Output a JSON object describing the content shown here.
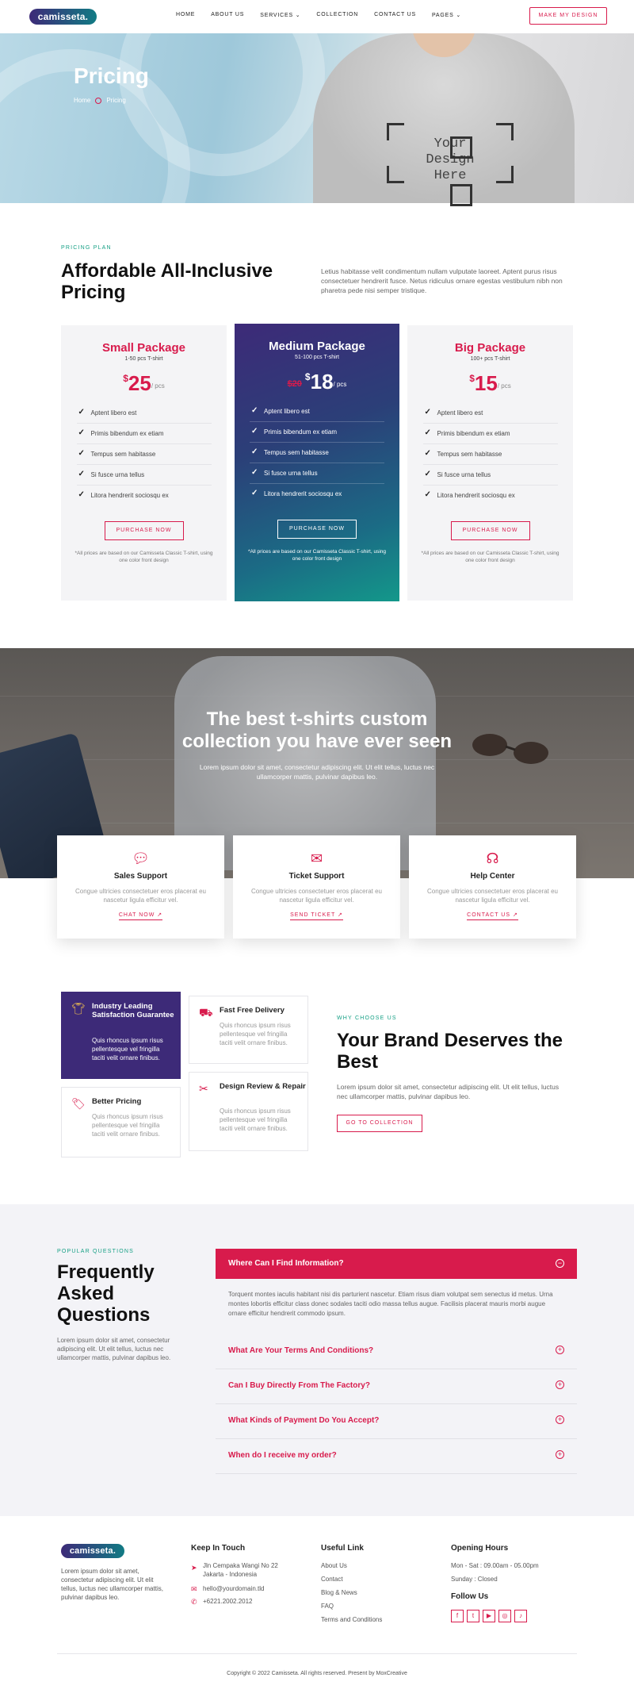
{
  "brand": {
    "logo": "camisseta.",
    "accent": "#d81b4c",
    "green": "#16a085",
    "purple": "#3d2a78"
  },
  "nav": {
    "items": [
      "HOME",
      "ABOUT US",
      "SERVICES",
      "COLLECTION",
      "CONTACT US",
      "PAGES"
    ],
    "active": "PAGES",
    "cta": "MAKE MY DESIGN"
  },
  "hero": {
    "title": "Pricing",
    "breadcrumb": [
      "Home",
      "Pricing"
    ],
    "design_text": "Your Design Here"
  },
  "pricing": {
    "eyebrow": "PRICING PLAN",
    "title": "Affordable All-Inclusive Pricing",
    "lead": "Letius habitasse velit condimentum nullam vulputate laoreet. Aptent purus risus consectetuer hendrerit fusce. Netus ridiculus ornare egestas vestibulum nibh non pharetra pede nisi semper tristique.",
    "plans": [
      {
        "name": "Small Package",
        "qty": "1-50 pcs T-shirt",
        "currency": "$",
        "price": "25",
        "per": "/ pcs",
        "old": "",
        "features": [
          "Aptent libero est",
          "Primis bibendum ex etiam",
          "Tempus sem habitasse",
          "Si fusce urna tellus",
          "Litora hendrerit sociosqu ex"
        ],
        "button": "PURCHASE NOW",
        "note": "*All prices are based on our Camisseta Classic T-shirt, using one color front design"
      },
      {
        "name": "Medium Package",
        "qty": "51-100 pcs T-shirt",
        "currency": "$",
        "price": "18",
        "per": "/ pcs",
        "old": "$20",
        "features": [
          "Aptent libero est",
          "Primis bibendum ex etiam",
          "Tempus sem habitasse",
          "Si fusce urna tellus",
          "Litora hendrerit sociosqu ex"
        ],
        "button": "PURCHASE NOW",
        "note": "*All prices are based on our Camisseta Classic T-shirt, using one color front design"
      },
      {
        "name": "Big Package",
        "qty": "100+ pcs T-shirt",
        "currency": "$",
        "price": "15",
        "per": "/ pcs",
        "old": "",
        "features": [
          "Aptent libero est",
          "Primis bibendum ex etiam",
          "Tempus sem habitasse",
          "Si fusce urna tellus",
          "Litora hendrerit sociosqu ex"
        ],
        "button": "PURCHASE NOW",
        "note": "*All prices are based on our Camisseta Classic T-shirt, using one color front design"
      }
    ]
  },
  "banner": {
    "title_line1": "The best t-shirts custom",
    "title_line2": "collection you have ever seen",
    "sub": "Lorem ipsum dolor sit amet, consectetur adipiscing elit. Ut elit tellus, luctus nec ullamcorper mattis, pulvinar dapibus leo."
  },
  "services": [
    {
      "icon": "chat-icon",
      "title": "Sales Support",
      "text": "Congue ultricies consectetuer eros placerat eu nascetur ligula efficitur vel.",
      "link": "CHAT NOW"
    },
    {
      "icon": "mail-icon",
      "title": "Ticket Support",
      "text": "Congue ultricies consectetuer eros placerat eu nascetur ligula efficitur vel.",
      "link": "SEND TICKET"
    },
    {
      "icon": "headset-icon",
      "title": "Help Center",
      "text": "Congue ultricies consectetuer eros placerat eu nascetur ligula efficitur vel.",
      "link": "CONTACT US"
    }
  ],
  "why": {
    "features": [
      {
        "icon": "tshirt-icon",
        "title": "Industry Leading Satisfaction Guarantee",
        "text": "Quis rhoncus ipsum risus pellentesque vel fringilla taciti velit ornare finibus."
      },
      {
        "icon": "truck-icon",
        "title": "Fast Free Delivery",
        "text": "Quis rhoncus ipsum risus pellentesque vel fringilla taciti velit ornare finibus."
      },
      {
        "icon": "tag-icon",
        "title": "Better Pricing",
        "text": "Quis rhoncus ipsum risus pellentesque vel fringilla taciti velit ornare finibus."
      },
      {
        "icon": "tools-icon",
        "title": "Design Review & Repair",
        "text": "Quis rhoncus ipsum risus pellentesque vel fringilla taciti velit ornare finibus."
      }
    ],
    "eyebrow": "WHY CHOOSE US",
    "title": "Your Brand Deserves the Best",
    "lead": "Lorem ipsum dolor sit amet, consectetur adipiscing elit. Ut elit tellus, luctus nec ullamcorper mattis, pulvinar dapibus leo.",
    "button": "GO TO COLLECTION"
  },
  "faq": {
    "eyebrow": "POPULAR QUESTIONS",
    "title": "Frequently Asked Questions",
    "lead": "Lorem ipsum dolor sit amet, consectetur adipiscing elit. Ut elit tellus, luctus nec ullamcorper mattis, pulvinar dapibus leo.",
    "open_q": "Where Can I Find Information?",
    "open_a": "Torquent montes iaculis habitant nisi dis parturient nascetur. Etiam risus diam volutpat sem senectus id metus. Urna montes lobortis efficitur class donec sodales taciti odio massa tellus augue. Facilisis placerat mauris morbi augue ornare efficitur hendrerit commodo ipsum.",
    "questions": [
      "What Are Your Terms And Conditions?",
      "Can I Buy Directly From The Factory?",
      "What Kinds of Payment Do You Accept?",
      "When do I receive my order?"
    ]
  },
  "footer": {
    "about": "Lorem ipsum dolor sit amet, consectetur adipiscing elit. Ut elit tellus, luctus nec ullamcorper mattis, pulvinar dapibus leo.",
    "touch_title": "Keep In Touch",
    "address": "Jln Cempaka Wangi No 22 Jakarta - Indonesia",
    "email": "hello@yourdomain.tld",
    "phone": "+6221.2002.2012",
    "links_title": "Useful Link",
    "links": [
      "About Us",
      "Contact",
      "Blog & News",
      "FAQ",
      "Terms and Conditions"
    ],
    "hours_title": "Opening Hours",
    "hours": [
      "Mon - Sat : 09.00am - 05.00pm",
      "Sunday : Closed"
    ],
    "follow_title": "Follow Us",
    "social": [
      "f",
      "t",
      "▶",
      "◎",
      "♪"
    ],
    "copyright": "Copyright © 2022 Camisseta. All rights reserved. Present by MoxCreative"
  }
}
